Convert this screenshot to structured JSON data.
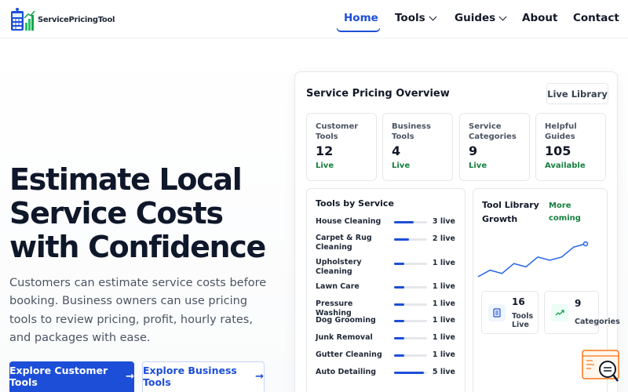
{
  "brand": {
    "name_part1": "Service",
    "name_part2": "PricingTool"
  },
  "nav": {
    "home": "Home",
    "tools": "Tools",
    "guides": "Guides",
    "about": "About",
    "contact": "Contact"
  },
  "hero": {
    "title": "Estimate Local Service Costs with Confidence",
    "text": "Customers can estimate service costs before booking. Business owners can use pricing tools to review pricing, profit, hourly rates, and packages with ease.",
    "primary_button": "Explore Customer Tools",
    "secondary_button": "Explore Business Tools"
  },
  "panel": {
    "title": "Service Pricing Overview",
    "live_button": "Live Library",
    "stats": [
      {
        "label": "Customer Tools",
        "value": "12",
        "status": "Live"
      },
      {
        "label": "Business Tools",
        "value": "4",
        "status": "Live"
      },
      {
        "label": "Service Categories",
        "value": "9",
        "status": "Live"
      },
      {
        "label": "Helpful Guides",
        "value": "105",
        "status": "Available"
      }
    ],
    "tools_by_service": {
      "title": "Tools by Service",
      "rows": [
        {
          "name": "House Cleaning",
          "count": "3 live",
          "level": 0.6
        },
        {
          "name": "Carpet & Rug Cleaning",
          "count": "2 live",
          "level": 0.45
        },
        {
          "name": "Upholstery Cleaning",
          "count": "1 live",
          "level": 0.3
        },
        {
          "name": "Lawn Care",
          "count": "1 live",
          "level": 0.3
        },
        {
          "name": "Pressure Washing",
          "count": "1 live",
          "level": 0.3
        },
        {
          "name": "Dog Grooming",
          "count": "1 live",
          "level": 0.3
        },
        {
          "name": "Junk Removal",
          "count": "1 live",
          "level": 0.3
        },
        {
          "name": "Gutter Cleaning",
          "count": "1 live",
          "level": 0.3
        },
        {
          "name": "Auto Detailing",
          "count": "5 live",
          "level": 0.9
        }
      ]
    },
    "growth": {
      "title": "Tool Library Growth",
      "more": "More coming",
      "series": [
        3,
        5,
        4,
        7,
        6,
        9,
        8,
        9,
        12,
        13
      ],
      "tools_live_value": "16",
      "tools_live_label": "Tools Live",
      "categories_value": "9",
      "categories_label": "Categories"
    }
  },
  "colors": {
    "accent": "#1d4ed8",
    "success": "#15803d",
    "help_orange": "#f97316"
  }
}
